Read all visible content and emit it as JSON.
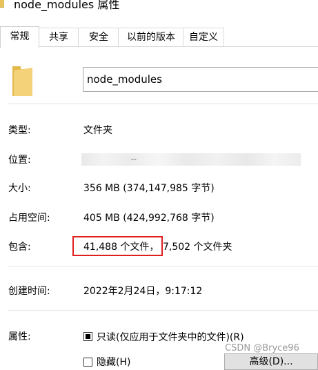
{
  "window": {
    "title": "node_modules 属性"
  },
  "tabs": [
    {
      "label": "常规",
      "active": true
    },
    {
      "label": "共享"
    },
    {
      "label": "安全"
    },
    {
      "label": "以前的版本"
    },
    {
      "label": "自定义"
    }
  ],
  "name_field": {
    "value": "node_modules"
  },
  "rows": {
    "type": {
      "label": "类型:",
      "value": "文件夹"
    },
    "location": {
      "label": "位置:",
      "value": "--"
    },
    "size": {
      "label": "大小:",
      "value": "356 MB (374,147,985 字节)"
    },
    "disk": {
      "label": "占用空间:",
      "value": "405 MB (424,992,768 字节)"
    },
    "contains": {
      "label": "包含:",
      "files": "41,488 个文件，",
      "folders": "7,502 个文件夹"
    },
    "created": {
      "label": "创建时间:",
      "value": "2022年2月24日，9:17:12"
    }
  },
  "attributes": {
    "label": "属性:",
    "readonly": "只读(仅应用于文件夹中的文件)(R)",
    "hidden": "隐藏(H)",
    "advanced_button": "高级(D)..."
  },
  "watermark": "CSDN @Bryce96",
  "colors": {
    "highlight": "#e01e1e",
    "folder": "#e8c25a"
  }
}
